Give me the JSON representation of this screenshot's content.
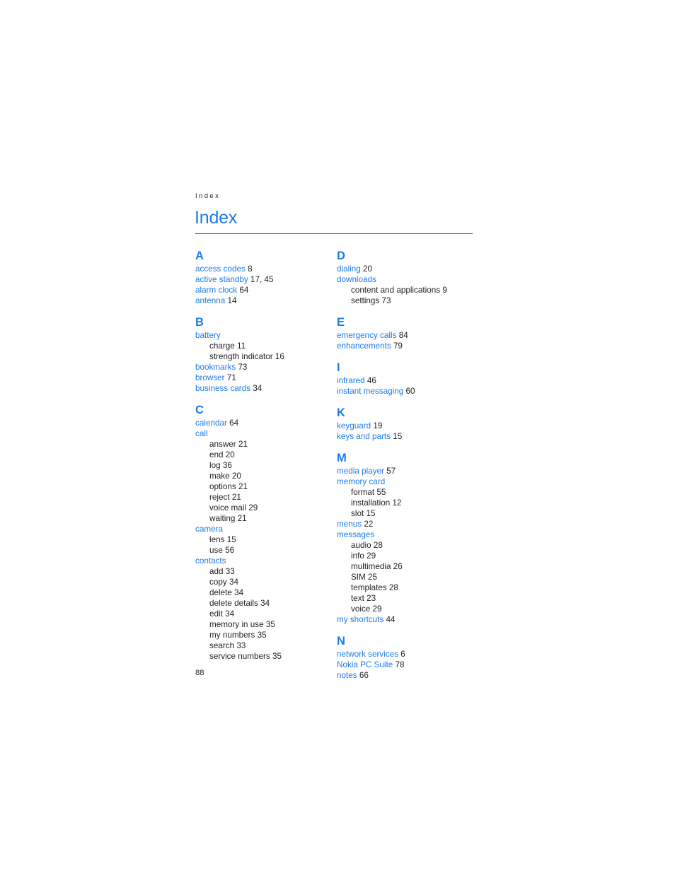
{
  "document": {
    "running_header": "Index",
    "title": "Index",
    "page_number": "88",
    "accent_color": "#1b7ce8",
    "text_color": "#231f20"
  },
  "columns": [
    {
      "name": "left-column",
      "sections": [
        {
          "letter": "A",
          "entries": [
            {
              "type": "entry",
              "term": "access codes",
              "page": "8"
            },
            {
              "type": "entry",
              "term": "active standby",
              "page": "17, 45"
            },
            {
              "type": "entry",
              "term": "alarm clock",
              "page": "64"
            },
            {
              "type": "entry",
              "term": "antenna",
              "page": "14"
            }
          ]
        },
        {
          "letter": "B",
          "entries": [
            {
              "type": "entry",
              "term": "battery",
              "page": ""
            },
            {
              "type": "subentry",
              "term": "charge",
              "page": "11"
            },
            {
              "type": "subentry",
              "term": "strength indicator",
              "page": "16"
            },
            {
              "type": "entry",
              "term": "bookmarks",
              "page": "73"
            },
            {
              "type": "entry",
              "term": "browser",
              "page": "71"
            },
            {
              "type": "entry",
              "term": "business cards",
              "page": "34"
            }
          ]
        },
        {
          "letter": "C",
          "entries": [
            {
              "type": "entry",
              "term": "calendar",
              "page": "64"
            },
            {
              "type": "entry",
              "term": "call",
              "page": ""
            },
            {
              "type": "subentry",
              "term": "answer",
              "page": "21"
            },
            {
              "type": "subentry",
              "term": "end",
              "page": "20"
            },
            {
              "type": "subentry",
              "term": "log",
              "page": "36"
            },
            {
              "type": "subentry",
              "term": "make",
              "page": "20"
            },
            {
              "type": "subentry",
              "term": "options",
              "page": "21"
            },
            {
              "type": "subentry",
              "term": "reject",
              "page": "21"
            },
            {
              "type": "subentry",
              "term": "voice mail",
              "page": "29"
            },
            {
              "type": "subentry",
              "term": "waiting",
              "page": "21"
            },
            {
              "type": "entry",
              "term": "camera",
              "page": ""
            },
            {
              "type": "subentry",
              "term": "lens",
              "page": "15"
            },
            {
              "type": "subentry",
              "term": "use",
              "page": "56"
            },
            {
              "type": "entry",
              "term": "contacts",
              "page": ""
            },
            {
              "type": "subentry",
              "term": "add",
              "page": "33"
            },
            {
              "type": "subentry",
              "term": "copy",
              "page": "34"
            },
            {
              "type": "subentry",
              "term": "delete",
              "page": "34"
            },
            {
              "type": "subentry",
              "term": "delete details",
              "page": "34"
            },
            {
              "type": "subentry",
              "term": "edit",
              "page": "34"
            },
            {
              "type": "subentry",
              "term": "memory in use",
              "page": "35"
            },
            {
              "type": "subentry",
              "term": "my numbers",
              "page": "35"
            },
            {
              "type": "subentry",
              "term": "search",
              "page": "33"
            },
            {
              "type": "subentry",
              "term": "service numbers",
              "page": "35"
            }
          ]
        }
      ]
    },
    {
      "name": "right-column",
      "sections": [
        {
          "letter": "D",
          "entries": [
            {
              "type": "entry",
              "term": "dialing",
              "page": "20"
            },
            {
              "type": "entry",
              "term": "downloads",
              "page": ""
            },
            {
              "type": "subentry",
              "term": "content and applications",
              "page": "9"
            },
            {
              "type": "subentry",
              "term": "settings",
              "page": "73"
            }
          ]
        },
        {
          "letter": "E",
          "entries": [
            {
              "type": "entry",
              "term": "emergency calls",
              "page": "84"
            },
            {
              "type": "entry",
              "term": "enhancements",
              "page": "79"
            }
          ]
        },
        {
          "letter": "I",
          "entries": [
            {
              "type": "entry",
              "term": "infrared",
              "page": "46"
            },
            {
              "type": "entry",
              "term": "instant messaging",
              "page": "60"
            }
          ]
        },
        {
          "letter": "K",
          "entries": [
            {
              "type": "entry",
              "term": "keyguard",
              "page": "19"
            },
            {
              "type": "entry",
              "term": "keys and parts",
              "page": "15"
            }
          ]
        },
        {
          "letter": "M",
          "entries": [
            {
              "type": "entry",
              "term": "media player",
              "page": "57"
            },
            {
              "type": "entry",
              "term": "memory card",
              "page": ""
            },
            {
              "type": "subentry",
              "term": "format",
              "page": "55"
            },
            {
              "type": "subentry",
              "term": "installation",
              "page": "12"
            },
            {
              "type": "subentry",
              "term": "slot",
              "page": "15"
            },
            {
              "type": "entry",
              "term": "menus",
              "page": "22"
            },
            {
              "type": "entry",
              "term": "messages",
              "page": ""
            },
            {
              "type": "subentry",
              "term": "audio",
              "page": "28"
            },
            {
              "type": "subentry",
              "term": "info",
              "page": "29"
            },
            {
              "type": "subentry",
              "term": "multimedia",
              "page": "26"
            },
            {
              "type": "subentry",
              "term": "SIM",
              "page": "25"
            },
            {
              "type": "subentry",
              "term": "templates",
              "page": "28"
            },
            {
              "type": "subentry",
              "term": "text",
              "page": "23"
            },
            {
              "type": "subentry",
              "term": "voice",
              "page": "29"
            },
            {
              "type": "entry",
              "term": "my shortcuts",
              "page": "44"
            }
          ]
        },
        {
          "letter": "N",
          "entries": [
            {
              "type": "entry",
              "term": "network services",
              "page": "6"
            },
            {
              "type": "entry",
              "term": "Nokia PC Suite",
              "page": "78"
            },
            {
              "type": "entry",
              "term": "notes",
              "page": "66"
            }
          ]
        }
      ]
    }
  ]
}
